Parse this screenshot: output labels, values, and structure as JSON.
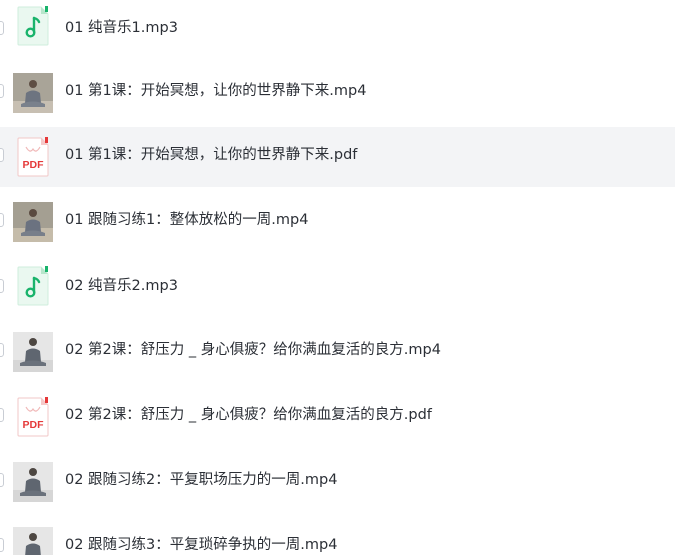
{
  "files": [
    {
      "name": "01 纯音乐1.mp3",
      "type": "audio",
      "icon": "music-note-icon"
    },
    {
      "name": "01 第1课：开始冥想，让你的世界静下来.mp4",
      "type": "video",
      "icon": "video-thumbnail"
    },
    {
      "name": "01 第1课：开始冥想，让你的世界静下来.pdf",
      "type": "pdf",
      "icon": "pdf-icon",
      "pdf_label": "PDF"
    },
    {
      "name": "01 跟随习练1：整体放松的一周.mp4",
      "type": "video",
      "icon": "video-thumbnail"
    },
    {
      "name": "02 纯音乐2.mp3",
      "type": "audio",
      "icon": "music-note-icon"
    },
    {
      "name": "02 第2课：舒压力 _ 身心俱疲？给你满血复活的良方.mp4",
      "type": "video",
      "icon": "video-thumbnail"
    },
    {
      "name": "02 第2课：舒压力 _ 身心俱疲？给你满血复活的良方.pdf",
      "type": "pdf",
      "icon": "pdf-icon",
      "pdf_label": "PDF"
    },
    {
      "name": "02 跟随习练2：平复职场压力的一周.mp4",
      "type": "video",
      "icon": "video-thumbnail"
    },
    {
      "name": "02 跟随习练3：平复琐碎争执的一周.mp4",
      "type": "video",
      "icon": "video-thumbnail"
    }
  ],
  "colors": {
    "audio_green": "#19b36b",
    "pdf_red": "#e5393a",
    "highlight_bg": "#f3f4f6",
    "text": "#2b2f36"
  }
}
